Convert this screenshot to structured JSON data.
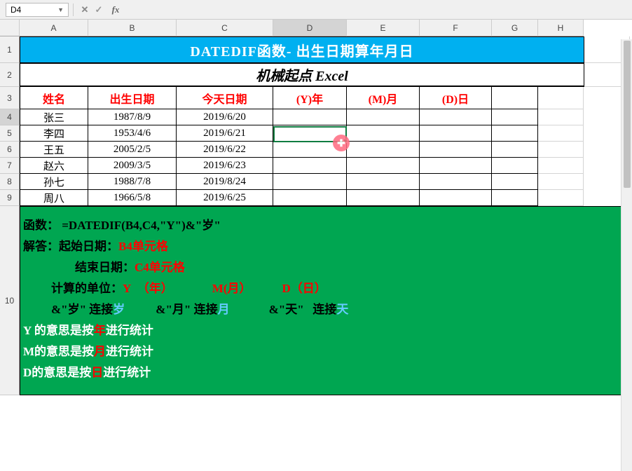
{
  "nameBox": "D4",
  "columns": [
    "A",
    "B",
    "C",
    "D",
    "E",
    "F",
    "G",
    "H"
  ],
  "rows": [
    "1",
    "2",
    "3",
    "4",
    "5",
    "6",
    "7",
    "8",
    "9",
    "10"
  ],
  "title": "DATEDIF函数- 出生日期算年月日",
  "subtitle": "机械起点 Excel",
  "headers": {
    "a": "姓名",
    "b": "出生日期",
    "c": "今天日期",
    "d": "(Y)年",
    "e": "(M)月",
    "f": "(D)日"
  },
  "dataRows": [
    {
      "name": "张三",
      "birth": "1987/8/9",
      "today": "2019/6/20"
    },
    {
      "name": "李四",
      "birth": "1953/4/6",
      "today": "2019/6/21"
    },
    {
      "name": "王五",
      "birth": "2005/2/5",
      "today": "2019/6/22"
    },
    {
      "name": "赵六",
      "birth": "2009/3/5",
      "today": "2019/6/23"
    },
    {
      "name": "孙七",
      "birth": "1988/7/8",
      "today": "2019/8/24"
    },
    {
      "name": "周八",
      "birth": "1966/5/8",
      "today": "2019/6/25"
    }
  ],
  "explain": {
    "l1_label": "函数：",
    "l1_formula": "=DATEDIF(B4,C4,\"Y\")&\"岁\"",
    "l2_label": "解答：",
    "l2a": "起始日期：",
    "l2b": "B4单元格",
    "l3a": "结束日期：",
    "l3b": "C4单元格",
    "l4a": "计算的单位：",
    "l4y": "Y",
    "l4yp": "（年）",
    "l4m": "M(月）",
    "l4d": "D（日）",
    "l5a": "&\"岁\"",
    "l5b": "连接",
    "l5c": "岁",
    "l5d": "&\"月\"",
    "l5e": "连接",
    "l5f": "月",
    "l5g": "&\"天\"",
    "l5h": "连接",
    "l5i": "天",
    "l6a": "Y 的意思是按",
    "l6b": "年",
    "l6c": "进行统计",
    "l7a": "M的意思是按",
    "l7b": "月",
    "l7c": "进行统计",
    "l8a": "D的意思是按",
    "l8b": "日",
    "l8c": "进行统计"
  },
  "buttons": {
    "cancel": "✕",
    "confirm": "✓",
    "fx": "fx"
  }
}
